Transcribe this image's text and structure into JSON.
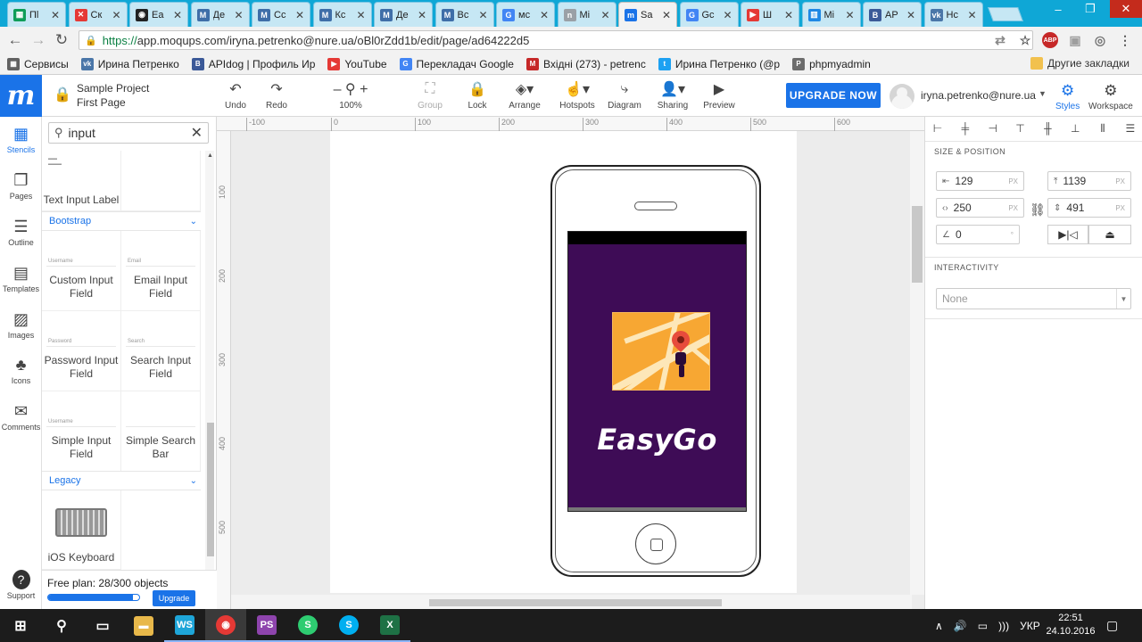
{
  "browser": {
    "tabs": [
      {
        "title": "Пl",
        "fav": "▦",
        "color": "#0f9d58"
      },
      {
        "title": "Ск",
        "fav": "✕",
        "color": "#e53935"
      },
      {
        "title": "Еа",
        "fav": "◉",
        "color": "#222222"
      },
      {
        "title": "Де",
        "fav": "M",
        "color": "#3f6ea8"
      },
      {
        "title": "Сс",
        "fav": "M",
        "color": "#3f6ea8"
      },
      {
        "title": "Кс",
        "fav": "M",
        "color": "#3f6ea8"
      },
      {
        "title": "Де",
        "fav": "M",
        "color": "#3f6ea8"
      },
      {
        "title": "Вс",
        "fav": "M",
        "color": "#3f6ea8"
      },
      {
        "title": "мс",
        "fav": "G",
        "color": "#4285f4"
      },
      {
        "title": "Мі",
        "fav": "n",
        "color": "#9aa0a6"
      },
      {
        "title": "Sa",
        "fav": "m",
        "color": "#1a73e8"
      },
      {
        "title": "Gc",
        "fav": "G",
        "color": "#4285f4"
      },
      {
        "title": "Ш",
        "fav": "▶",
        "color": "#e53935"
      },
      {
        "title": "Мі",
        "fav": "▥",
        "color": "#1e88e5"
      },
      {
        "title": "АР",
        "fav": "B",
        "color": "#3b5998"
      },
      {
        "title": "Нс",
        "fav": "vk",
        "color": "#4a76a8"
      }
    ],
    "active_tab": 10,
    "url_scheme": "https://",
    "url_rest": "app.moqups.com/iryna.petrenko@nure.ua/oBl0rZdd1b/edit/page/ad64222d5",
    "omni_icons": [
      {
        "name": "translate-icon",
        "glyph": "⇄",
        "color": "#888888"
      },
      {
        "name": "star-icon",
        "glyph": "☆",
        "color": "#555555"
      },
      {
        "name": "adblock-icon",
        "glyph": "ABP",
        "color": "#c62828"
      },
      {
        "name": "extension-icon",
        "glyph": "▣",
        "color": "#9e9e9e"
      },
      {
        "name": "camera-icon",
        "glyph": "◎",
        "color": "#757575"
      },
      {
        "name": "menu-icon",
        "glyph": "⋮",
        "color": "#555555"
      }
    ],
    "bookmarks": [
      {
        "label": "Сервисы",
        "fav": "▦",
        "color": "#616161"
      },
      {
        "label": "Ирина Петренко",
        "fav": "vk",
        "color": "#4a76a8"
      },
      {
        "label": "APIdog | Профиль Ир",
        "fav": "B",
        "color": "#3b5998"
      },
      {
        "label": "YouTube",
        "fav": "▶",
        "color": "#e53935"
      },
      {
        "label": "Перекладач Google",
        "fav": "G",
        "color": "#4285f4"
      },
      {
        "label": "Вхідні (273) - petrenc",
        "fav": "M",
        "color": "#c62828"
      },
      {
        "label": "Ирина Петренко (@р",
        "fav": "t",
        "color": "#1da1f2"
      },
      {
        "label": "phpmyadmin",
        "fav": "P",
        "color": "#6d6d6d"
      }
    ],
    "other_bookmarks": "Другие закладки"
  },
  "app": {
    "logo": "m",
    "project_name": "Sample Project",
    "page_name": "First Page",
    "tools": [
      {
        "name": "undo-button",
        "icon": "↶",
        "label": "Undo",
        "disabled": false
      },
      {
        "name": "redo-button",
        "icon": "↷",
        "label": "Redo",
        "disabled": false
      },
      {
        "name": "zoom-control",
        "icon": "–  ⚲  +",
        "label": "100%",
        "disabled": false
      },
      {
        "name": "group-button",
        "icon": "⛶",
        "label": "Group",
        "disabled": true
      },
      {
        "name": "lock-button",
        "icon": "🔒",
        "label": "Lock",
        "disabled": false
      },
      {
        "name": "arrange-button",
        "icon": "◈▾",
        "label": "Arrange",
        "disabled": false
      },
      {
        "name": "hotspots-button",
        "icon": "☝▾",
        "label": "Hotspots",
        "disabled": false
      },
      {
        "name": "diagram-button",
        "icon": "⤷",
        "label": "Diagram",
        "disabled": false
      },
      {
        "name": "sharing-button",
        "icon": "👤▾",
        "label": "Sharing",
        "disabled": false
      },
      {
        "name": "preview-button",
        "icon": "▶",
        "label": "Preview",
        "disabled": false
      }
    ],
    "upgrade_label": "UPGRADE NOW",
    "user_email": "iryna.petrenko@nure.ua",
    "styles_label": "Styles",
    "workspace_label": "Workspace"
  },
  "rail": [
    {
      "name": "rail-stencils",
      "icon": "▦",
      "label": "Stencils",
      "active": true
    },
    {
      "name": "rail-pages",
      "icon": "❐",
      "label": "Pages",
      "active": false
    },
    {
      "name": "rail-outline",
      "icon": "☰",
      "label": "Outline",
      "active": false
    },
    {
      "name": "rail-templates",
      "icon": "▤",
      "label": "Templates",
      "active": false
    },
    {
      "name": "rail-images",
      "icon": "▨",
      "label": "Images",
      "active": false
    },
    {
      "name": "rail-icons",
      "icon": "♣",
      "label": "Icons",
      "active": false
    },
    {
      "name": "rail-comments",
      "icon": "✉",
      "label": "Comments",
      "active": false
    },
    {
      "name": "rail-support",
      "icon": "?",
      "label": "Support",
      "active": false
    }
  ],
  "stencils": {
    "search_value": "input",
    "first_item": "Text Input Label",
    "bootstrap_header": "Bootstrap",
    "bootstrap_items": [
      {
        "label": "Custom Input Field",
        "preview": "Username"
      },
      {
        "label": "Email Input Field",
        "preview": "Email"
      },
      {
        "label": "Password Input Field",
        "preview": "Password"
      },
      {
        "label": "Search Input Field",
        "preview": "Search"
      },
      {
        "label": "Simple Input Field",
        "preview": "Username"
      },
      {
        "label": "Simple Search Bar",
        "preview": ""
      }
    ],
    "legacy_header": "Legacy",
    "legacy_items": [
      {
        "label": "iOS Keyboard"
      }
    ],
    "plan_text": "Free plan: 28/300 objects",
    "plan_progress": 0.93,
    "upgrade_small": "Upgrade"
  },
  "canvas": {
    "ruler_top": [
      "-100",
      "0",
      "100",
      "200",
      "300",
      "400",
      "500",
      "600"
    ],
    "ruler_left": [
      "100",
      "200",
      "300",
      "400",
      "500"
    ],
    "app_name": "EasyGo"
  },
  "properties": {
    "size_position_title": "SIZE & POSITION",
    "x": "129",
    "y": "1139",
    "width": "250",
    "height": "491",
    "rotation": "0",
    "unit": "PX",
    "deg": "°",
    "interactivity_title": "INTERACTIVITY",
    "interactivity_value": "None"
  },
  "taskbar": {
    "apps": [
      {
        "name": "start-button",
        "glyph": "⊞",
        "color": "transparent"
      },
      {
        "name": "search-button",
        "glyph": "⚲",
        "color": "transparent"
      },
      {
        "name": "task-view-button",
        "glyph": "▭",
        "color": "transparent"
      },
      {
        "name": "explorer-app",
        "glyph": "▬",
        "color": "#e8b84a"
      },
      {
        "name": "webstorm-app",
        "glyph": "WS",
        "color": "#1ea5d8"
      },
      {
        "name": "chrome-app",
        "glyph": "◉",
        "color": "#e53935"
      },
      {
        "name": "phpstorm-app",
        "glyph": "PS",
        "color": "#8e44ad"
      },
      {
        "name": "s-app",
        "glyph": "S",
        "color": "#2ecc71"
      },
      {
        "name": "skype-app",
        "glyph": "S",
        "color": "#00aff0"
      },
      {
        "name": "excel-app",
        "glyph": "X",
        "color": "#1e7145"
      }
    ],
    "lang": "УКР",
    "time": "22:51",
    "date": "24.10.2016"
  }
}
